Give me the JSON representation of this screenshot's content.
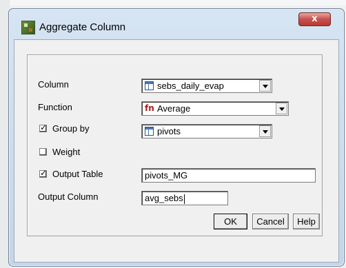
{
  "dialog": {
    "title": "Aggregate Column",
    "close_glyph": "x"
  },
  "form": {
    "column": {
      "label": "Column",
      "value": "sebs_daily_evap",
      "icon": "table-icon"
    },
    "function": {
      "label": "Function",
      "value": "Average",
      "icon": "fn-icon",
      "icon_text": "fn"
    },
    "group_by": {
      "label": "Group by",
      "checked": true,
      "value": "pivots",
      "icon": "table-icon"
    },
    "weight": {
      "label": "Weight",
      "checked": false
    },
    "output_table": {
      "label": "Output Table",
      "checked": true,
      "value": "pivots_MG"
    },
    "output_column": {
      "label": "Output Column",
      "value": "avg_sebs"
    }
  },
  "buttons": {
    "ok": "OK",
    "cancel": "Cancel",
    "help": "Help"
  }
}
